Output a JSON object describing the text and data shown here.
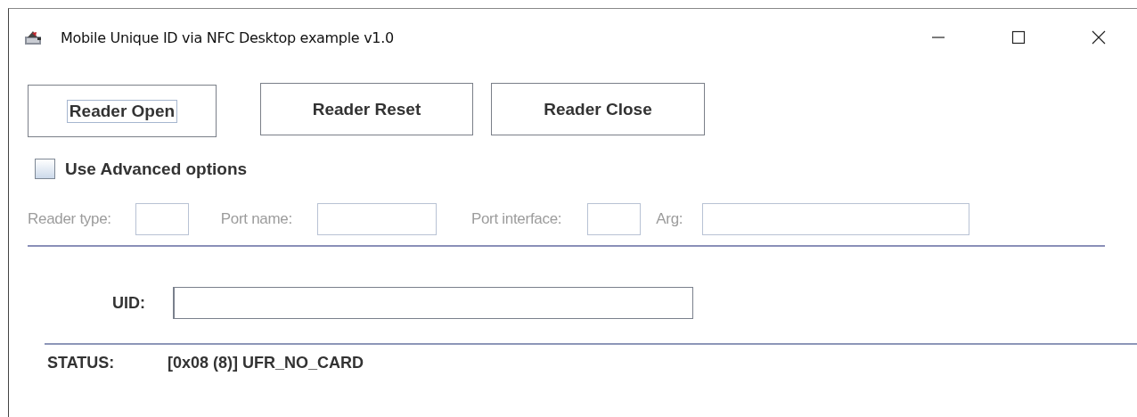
{
  "window": {
    "title": "Mobile Unique ID via NFC Desktop example v1.0"
  },
  "buttons": [
    {
      "label": "Reader Open",
      "focused": true
    },
    {
      "label": "Reader Reset",
      "focused": false
    },
    {
      "label": "Reader Close",
      "focused": false
    }
  ],
  "advanced_checkbox": {
    "label": "Use Advanced options",
    "checked": false
  },
  "advanced_fields": [
    {
      "label": "Reader type:",
      "disabled": true
    },
    {
      "label": "Port name:",
      "disabled": true
    },
    {
      "label": "Port interface:",
      "disabled": true
    },
    {
      "label": "Arg:",
      "disabled": true
    }
  ],
  "uid": {
    "label": "UID:"
  },
  "status": {
    "label": "STATUS:",
    "value": "[0x08 (8)] UFR_NO_CARD"
  }
}
